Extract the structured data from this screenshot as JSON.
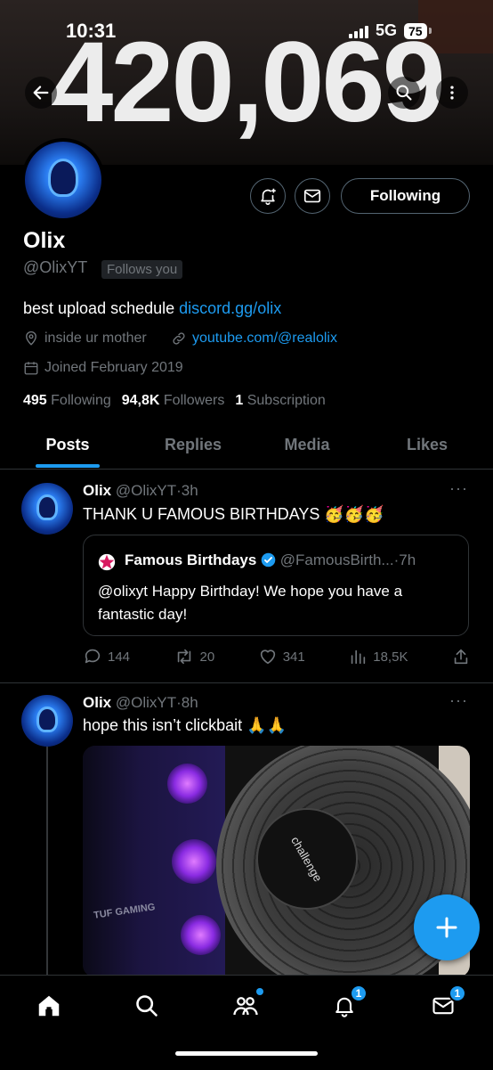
{
  "status_bar": {
    "time": "10:31",
    "network": "5G",
    "battery": "75"
  },
  "banner": {
    "count_text": "420,069"
  },
  "profile": {
    "name": "Olix",
    "handle": "@OlixYT",
    "follows_you": "Follows you",
    "bio_text": "best upload schedule ",
    "bio_link": "discord.gg/olix",
    "location": "inside ur mother",
    "website": "youtube.com/@realolix",
    "joined": "Joined February 2019",
    "following_count": "495",
    "following_label": "Following",
    "followers_count": "94,8K",
    "followers_label": "Followers",
    "subscription_count": "1",
    "subscription_label": "Subscription",
    "following_button": "Following"
  },
  "tabs": [
    {
      "label": "Posts",
      "active": true
    },
    {
      "label": "Replies",
      "active": false
    },
    {
      "label": "Media",
      "active": false
    },
    {
      "label": "Likes",
      "active": false
    }
  ],
  "tweets": [
    {
      "name": "Olix",
      "handle": "@OlixYT",
      "time": "3h",
      "text": "THANK U FAMOUS BIRTHDAYS 🥳🥳🥳",
      "quote": {
        "name": "Famous Birthdays",
        "handle": "@FamousBirth...",
        "time": "7h",
        "text": "@olixyt Happy Birthday! We hope you have a fantastic day!"
      },
      "replies": "144",
      "reposts": "20",
      "likes": "341",
      "views": "18,5K"
    },
    {
      "name": "Olix",
      "handle": "@OlixYT",
      "time": "8h",
      "text": "hope this isn’t clickbait 🙏🙏",
      "media_text": "challenge",
      "pc_text": "TUF GAMING"
    }
  ],
  "bottom_nav": {
    "communities_dot": true,
    "notifications_badge": "1",
    "messages_badge": "1"
  },
  "colors": {
    "accent": "#1d9bf0",
    "muted": "#71767b",
    "border": "#2f3336",
    "background": "#000000"
  }
}
